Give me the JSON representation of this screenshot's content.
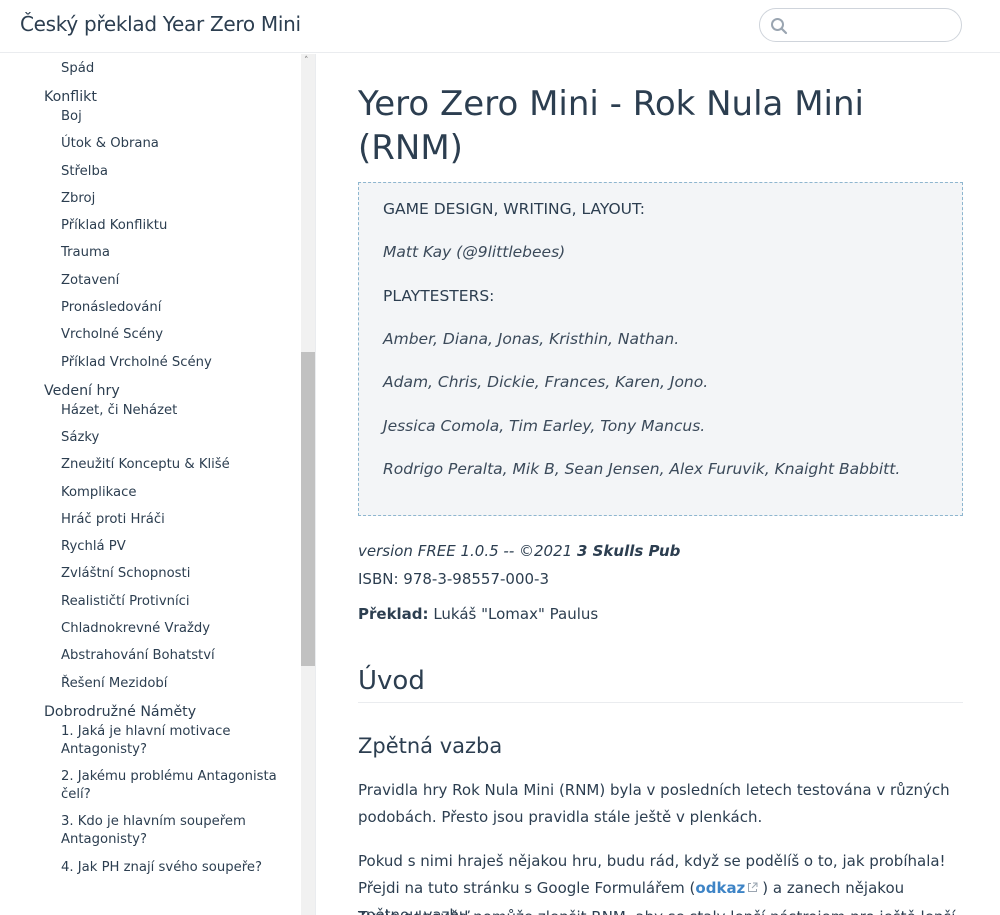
{
  "header": {
    "site_title": "Český překlad Year Zero Mini",
    "search_placeholder": ""
  },
  "sidebar": {
    "items": [
      {
        "label": "Spád",
        "level": 2
      },
      {
        "label": "Konflikt",
        "level": 1
      },
      {
        "label": "Boj",
        "level": 2
      },
      {
        "label": "Útok & Obrana",
        "level": 2
      },
      {
        "label": "Střelba",
        "level": 2
      },
      {
        "label": "Zbroj",
        "level": 2
      },
      {
        "label": "Příklad Konfliktu",
        "level": 2
      },
      {
        "label": "Trauma",
        "level": 2
      },
      {
        "label": "Zotavení",
        "level": 2
      },
      {
        "label": "Pronásledování",
        "level": 2
      },
      {
        "label": "Vrcholné Scény",
        "level": 2
      },
      {
        "label": "Příklad Vrcholné Scény",
        "level": 2
      },
      {
        "label": "Vedení hry",
        "level": 1
      },
      {
        "label": "Házet, či Neházet",
        "level": 2
      },
      {
        "label": "Sázky",
        "level": 2
      },
      {
        "label": "Zneužití Konceptu & Klišé",
        "level": 2
      },
      {
        "label": "Komplikace",
        "level": 2
      },
      {
        "label": "Hráč proti Hráči",
        "level": 2
      },
      {
        "label": "Rychlá PV",
        "level": 2
      },
      {
        "label": "Zvláštní Schopnosti",
        "level": 2
      },
      {
        "label": "Realističtí Protivníci",
        "level": 2
      },
      {
        "label": "Chladnokrevné Vraždy",
        "level": 2
      },
      {
        "label": "Abstrahování Bohatství",
        "level": 2
      },
      {
        "label": "Řešení Mezidobí",
        "level": 2
      },
      {
        "label": "Dobrodružné Náměty",
        "level": 1
      },
      {
        "label": "1. Jaká je hlavní motivace Antagonisty?",
        "level": 2
      },
      {
        "label": "2. Jakému problému Antagonista čelí?",
        "level": 2
      },
      {
        "label": "3. Kdo je hlavním soupeřem Antagonisty?",
        "level": 2
      },
      {
        "label": "4. Jak PH znají svého soupeře?",
        "level": 2
      }
    ]
  },
  "main": {
    "title": "Yero Zero Mini - Rok Nula Mini (RNM)",
    "credits": {
      "design_label": "GAME DESIGN, WRITING, LAYOUT:",
      "design_name": "Matt Kay (@9littlebees)",
      "playtesters_label": "PLAYTESTERS:",
      "playtesters": [
        "Amber, Diana, Jonas, Kristhin, Nathan.",
        "Adam, Chris, Dickie, Frances, Karen, Jono.",
        "Jessica Comola, Tim Earley, Tony Mancus.",
        "Rodrigo Peralta, Mik B, Sean Jensen, Alex Furuvik, Knaight Babbitt."
      ]
    },
    "version_text": "version FREE 1.0.5 -- ©2021 ",
    "publisher": "3 Skulls Pub",
    "isbn": "ISBN: 978-3-98557-000-3",
    "translation_label": "Překlad:",
    "translator": " Lukáš \"Lomax\" Paulus",
    "section_heading": "Úvod",
    "subsection_heading": "Zpětná vazba",
    "para1": "Pravidla hry Rok Nula Mini (RNM) byla v posledních letech testována v různých podobách. Přesto jsou pravidla stále ještě v plenkách.",
    "para2_before": "Pokud s nimi hraješ nějakou hru, budu rád, když se podělíš o to, jak probíhala! Přejdi na tuto stránku s Google Formulářem (",
    "para2_link": "odkaz",
    "para2_after": ") a zanech nějakou zpětnou vazbu.",
    "para3": "Tvoje odpověď pomůže zlepšit RNM, aby se staly lepší nástrojem pro ještě lepší hru."
  },
  "colors": {
    "text": "#2c3e50",
    "link": "#3e84c6",
    "credits_bg": "#f3f5f7",
    "credits_border": "#8eb6cf"
  }
}
